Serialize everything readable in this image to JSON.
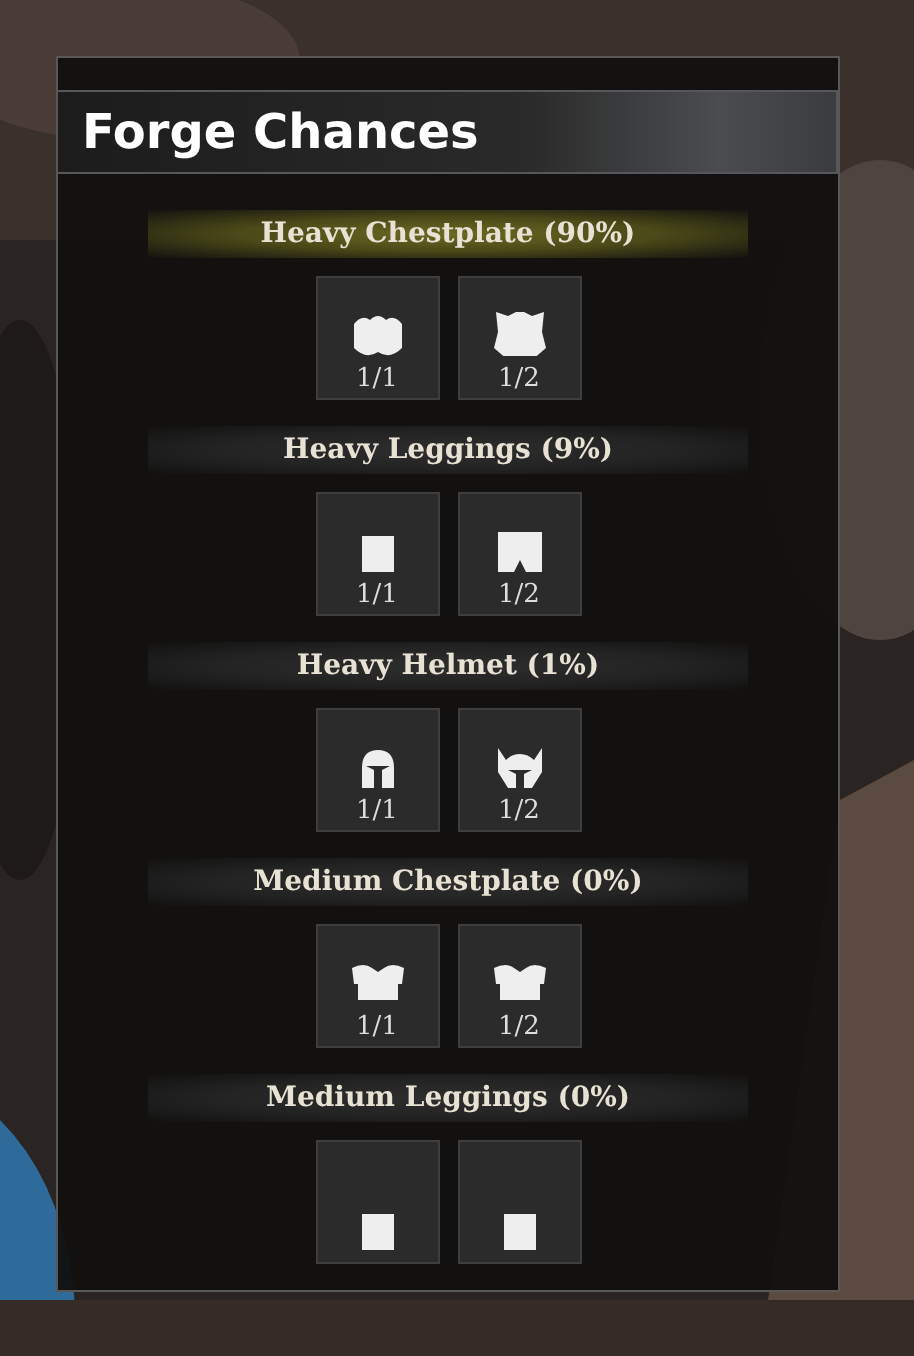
{
  "panel": {
    "title": "Forge Chances"
  },
  "groups": [
    {
      "label": "Heavy Chestplate (90%)",
      "selected": true,
      "slots": [
        {
          "kind": "chestplate",
          "count": "1/1"
        },
        {
          "kind": "chestplate-wide",
          "count": "1/2"
        }
      ]
    },
    {
      "label": "Heavy Leggings (9%)",
      "selected": false,
      "slots": [
        {
          "kind": "leggings",
          "count": "1/1"
        },
        {
          "kind": "leggings-wide",
          "count": "1/2"
        }
      ]
    },
    {
      "label": "Heavy Helmet (1%)",
      "selected": false,
      "slots": [
        {
          "kind": "helmet",
          "count": "1/1"
        },
        {
          "kind": "helmet-horned",
          "count": "1/2"
        }
      ]
    },
    {
      "label": "Medium Chestplate (0%)",
      "selected": false,
      "slots": [
        {
          "kind": "vest",
          "count": "1/1"
        },
        {
          "kind": "vest",
          "count": "1/2"
        }
      ]
    },
    {
      "label": "Medium Leggings (0%)",
      "selected": false,
      "slots": [
        {
          "kind": "leggings"
        },
        {
          "kind": "leggings"
        }
      ]
    }
  ]
}
